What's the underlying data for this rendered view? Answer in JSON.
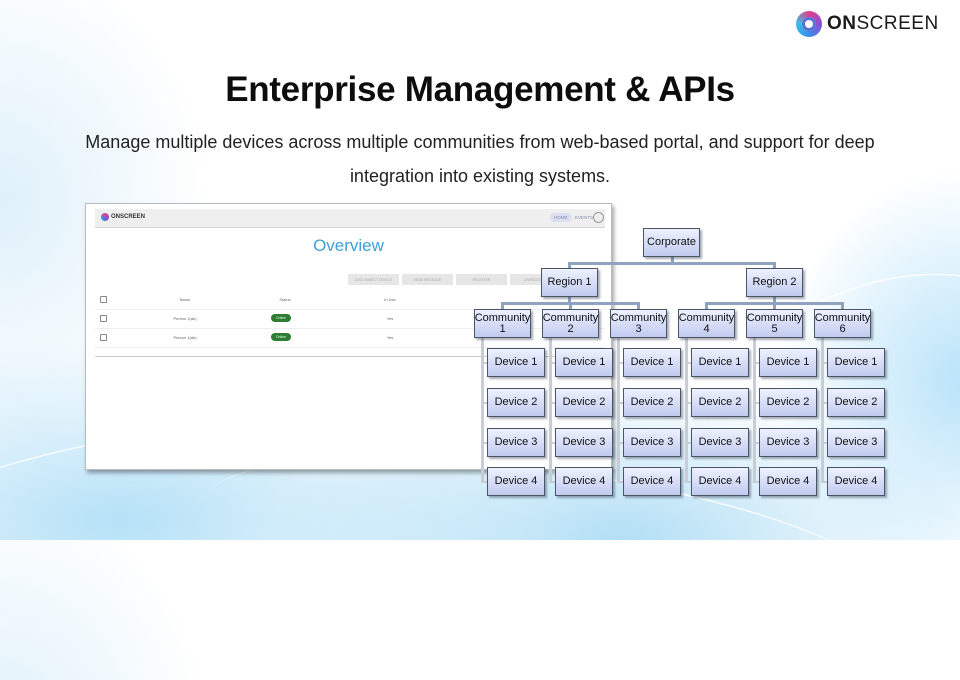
{
  "brand": {
    "name_bold": "ON",
    "name_rest": "SCREEN",
    "logo_icon": "aperture-logo"
  },
  "slide": {
    "title": "Enterprise Management & APIs",
    "subtitle": "Manage multiple devices across multiple communities from web-based portal, and support for deep integration into existing systems."
  },
  "portal": {
    "logo_text": "ONSCREEN",
    "nav": {
      "home": "HOME",
      "events": "EVENTS",
      "avatar_icon": "user-avatar-icon"
    },
    "page_title": "Overview",
    "actions": [
      "DISCONNECT DEVICE",
      "SEND MESSAGE",
      "REGISTER",
      "UNREGISTER"
    ],
    "table": {
      "headers": [
        "",
        "Name",
        "Status",
        "In Use"
      ],
      "rows": [
        {
          "name": "Person 1(ab)",
          "status": "Online",
          "in_use": "Yes"
        },
        {
          "name": "Person 1(ab)",
          "status": "Online",
          "in_use": "Yes"
        }
      ]
    }
  },
  "org_chart": {
    "root": "Corporate",
    "regions": [
      {
        "label": "Region 1",
        "communities": [
          "Community 1",
          "Community 2",
          "Community 3"
        ]
      },
      {
        "label": "Region 2",
        "communities": [
          "Community 4",
          "Community 5",
          "Community 6"
        ]
      }
    ],
    "devices": [
      "Device 1",
      "Device 2",
      "Device 3",
      "Device 4"
    ],
    "colors": {
      "node_top": "#eef1ff",
      "node_bottom": "#c2cbf0",
      "connector": "#8fa3c0"
    }
  }
}
